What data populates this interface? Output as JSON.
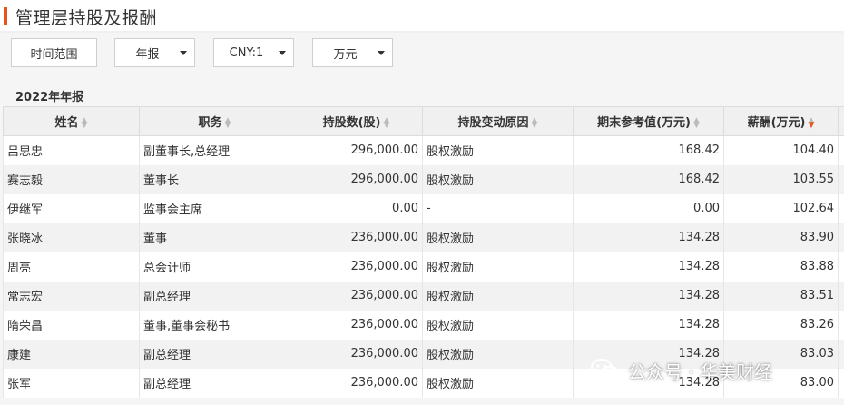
{
  "header": {
    "title": "管理层持股及报酬"
  },
  "toolbar": {
    "range_label": "时间范围",
    "period": {
      "value": "年报"
    },
    "currency": {
      "value": "CNY:1"
    },
    "unit": {
      "value": "万元"
    }
  },
  "section": {
    "year_label": "2022年年报"
  },
  "table": {
    "headers": [
      "姓名",
      "职务",
      "持股数(股)",
      "持股变动原因",
      "期末参考值(万元)",
      "薪酬(万元)"
    ],
    "rows": [
      [
        "吕思忠",
        "副董事长,总经理",
        "296,000.00",
        "股权激励",
        "168.42",
        "104.40"
      ],
      [
        "赛志毅",
        "董事长",
        "296,000.00",
        "股权激励",
        "168.42",
        "103.55"
      ],
      [
        "伊继军",
        "监事会主席",
        "0.00",
        "-",
        "0.00",
        "102.64"
      ],
      [
        "张晓冰",
        "董事",
        "236,000.00",
        "股权激励",
        "134.28",
        "83.90"
      ],
      [
        "周亮",
        "总会计师",
        "236,000.00",
        "股权激励",
        "134.28",
        "83.88"
      ],
      [
        "常志宏",
        "副总经理",
        "236,000.00",
        "股权激励",
        "134.28",
        "83.51"
      ],
      [
        "隋荣昌",
        "董事,董事会秘书",
        "236,000.00",
        "股权激励",
        "134.28",
        "83.26"
      ],
      [
        "康建",
        "副总经理",
        "236,000.00",
        "股权激励",
        "134.28",
        "83.03"
      ],
      [
        "张军",
        "副总经理",
        "236,000.00",
        "股权激励",
        "134.28",
        "83.00"
      ]
    ]
  },
  "watermark": {
    "text": "公众号 · 华美财经"
  },
  "colors": {
    "accent": "#e8541e",
    "header_bg": "#f0f0f0",
    "stripe": "#f2f2f2"
  }
}
